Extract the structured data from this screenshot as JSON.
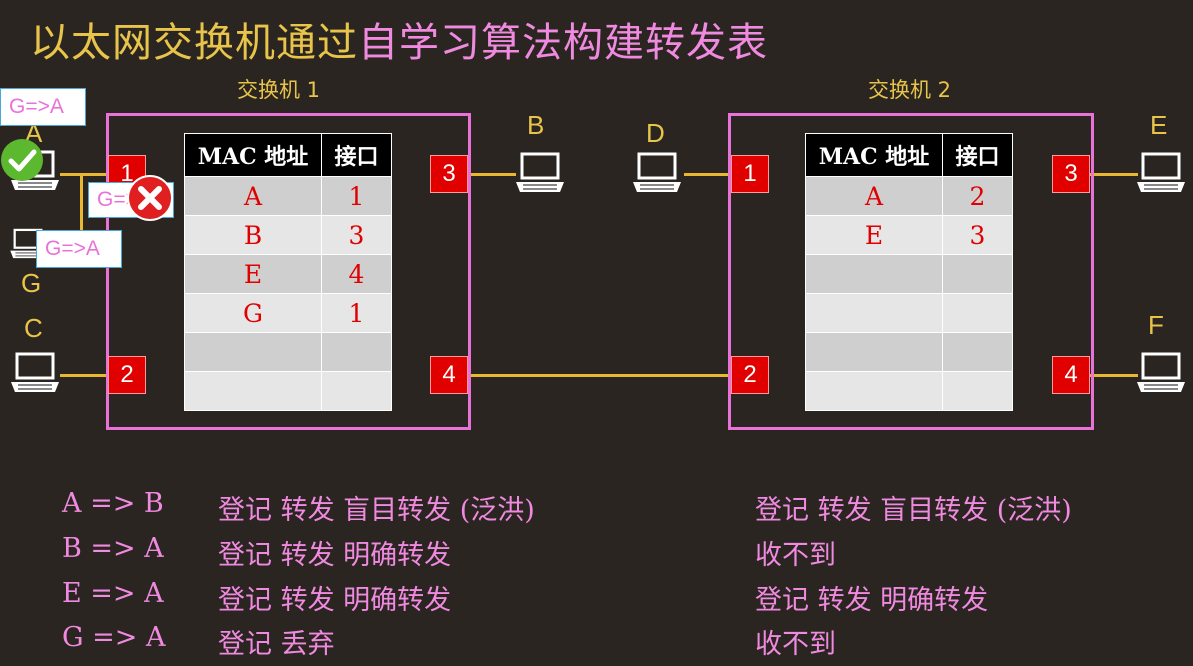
{
  "title": {
    "part1": "以太网交换机通过",
    "part2": "自学习算法构建转发表"
  },
  "switch1": {
    "label": "交换机 1",
    "ports": [
      "1",
      "2",
      "3",
      "4"
    ],
    "table": {
      "headers": [
        "MAC 地址",
        "接口"
      ],
      "rows": [
        [
          "A",
          "1"
        ],
        [
          "B",
          "3"
        ],
        [
          "E",
          "4"
        ],
        [
          "G",
          "1"
        ],
        [
          "",
          ""
        ],
        [
          "",
          ""
        ]
      ]
    }
  },
  "switch2": {
    "label": "交换机 2",
    "ports": [
      "1",
      "2",
      "3",
      "4"
    ],
    "table": {
      "headers": [
        "MAC 地址",
        "接口"
      ],
      "rows": [
        [
          "A",
          "2"
        ],
        [
          "E",
          "3"
        ],
        [
          "",
          ""
        ],
        [
          "",
          ""
        ],
        [
          "",
          ""
        ],
        [
          "",
          ""
        ]
      ]
    }
  },
  "hosts": {
    "A": "A",
    "B": "B",
    "C": "C",
    "D": "D",
    "E": "E",
    "F": "F",
    "G": "G"
  },
  "frames": {
    "tag1": "G=>A",
    "tag2": "G=>A",
    "tag3": "G=>A"
  },
  "log": {
    "rows": [
      {
        "frame": "A => B",
        "sw1": "登记  转发 盲目转发 (泛洪)",
        "sw2": "登记   转发 盲目转发 (泛洪)"
      },
      {
        "frame": "B => A",
        "sw1": "登记  转发 明确转发",
        "sw2": "收不到"
      },
      {
        "frame": "E => A",
        "sw1": "登记  转发 明确转发",
        "sw2": "登记    转发  明确转发"
      },
      {
        "frame": "G => A",
        "sw1": "登记  丢弃",
        "sw2": "收不到"
      }
    ]
  },
  "colors": {
    "accent_yellow": "#e8c44a",
    "accent_pink": "#f08ae0",
    "port_red": "#e00000",
    "check_green": "#5cb82e",
    "cross_red": "#e02020"
  }
}
